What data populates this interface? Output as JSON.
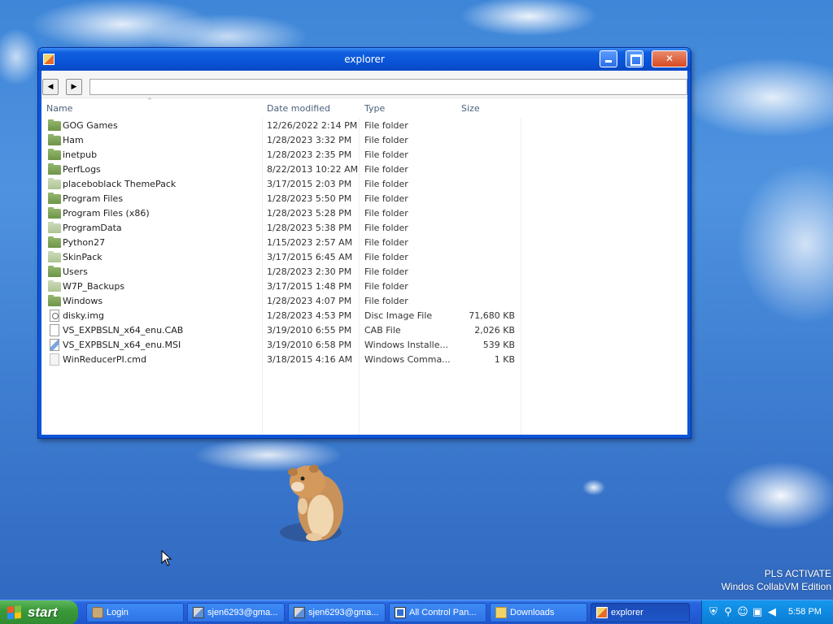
{
  "window": {
    "title": "explorer",
    "address_value": "",
    "nav_back_glyph": "◀",
    "nav_forward_glyph": "▶"
  },
  "list": {
    "columns": [
      "Name",
      "Date modified",
      "Type",
      "Size"
    ],
    "sort_indicator": "^",
    "rows": [
      {
        "name": "GOG Games",
        "date": "12/26/2022 2:14 PM",
        "type": "File folder",
        "size": "",
        "icon": "folder-icon"
      },
      {
        "name": "Ham",
        "date": "1/28/2023 3:32 PM",
        "type": "File folder",
        "size": "",
        "icon": "folder-icon"
      },
      {
        "name": "inetpub",
        "date": "1/28/2023 2:35 PM",
        "type": "File folder",
        "size": "",
        "icon": "folder-icon"
      },
      {
        "name": "PerfLogs",
        "date": "8/22/2013 10:22 AM",
        "type": "File folder",
        "size": "",
        "icon": "folder-icon"
      },
      {
        "name": "placeboblack ThemePack",
        "date": "3/17/2015 2:03 PM",
        "type": "File folder",
        "size": "",
        "icon": "folder-light-icon"
      },
      {
        "name": "Program Files",
        "date": "1/28/2023 5:50 PM",
        "type": "File folder",
        "size": "",
        "icon": "folder-icon"
      },
      {
        "name": "Program Files (x86)",
        "date": "1/28/2023 5:28 PM",
        "type": "File folder",
        "size": "",
        "icon": "folder-icon"
      },
      {
        "name": "ProgramData",
        "date": "1/28/2023 5:38 PM",
        "type": "File folder",
        "size": "",
        "icon": "folder-light-icon"
      },
      {
        "name": "Python27",
        "date": "1/15/2023 2:57 AM",
        "type": "File folder",
        "size": "",
        "icon": "folder-icon"
      },
      {
        "name": "SkinPack",
        "date": "3/17/2015 6:45 AM",
        "type": "File folder",
        "size": "",
        "icon": "folder-light-icon"
      },
      {
        "name": "Users",
        "date": "1/28/2023 2:30 PM",
        "type": "File folder",
        "size": "",
        "icon": "folder-icon"
      },
      {
        "name": "W7P_Backups",
        "date": "3/17/2015 1:48 PM",
        "type": "File folder",
        "size": "",
        "icon": "folder-light-icon"
      },
      {
        "name": "Windows",
        "date": "1/28/2023 4:07 PM",
        "type": "File folder",
        "size": "",
        "icon": "folder-icon"
      },
      {
        "name": "disky.img",
        "date": "1/28/2023 4:53 PM",
        "type": "Disc Image File",
        "size": "71,680 KB",
        "icon": "disk-image-icon"
      },
      {
        "name": "VS_EXPBSLN_x64_enu.CAB",
        "date": "3/19/2010 6:55 PM",
        "type": "CAB File",
        "size": "2,026 KB",
        "icon": "file-icon"
      },
      {
        "name": "VS_EXPBSLN_x64_enu.MSI",
        "date": "3/19/2010 6:58 PM",
        "type": "Windows Installe...",
        "size": "539 KB",
        "icon": "installer-icon"
      },
      {
        "name": "WinReducerPI.cmd",
        "date": "3/18/2015 4:16 AM",
        "type": "Windows Comma...",
        "size": "1 KB",
        "icon": "cmd-file-icon"
      }
    ]
  },
  "desktop": {
    "watermark_line1": "PLS ACTIVATE",
    "watermark_line2": "Windos CollabVM Edition"
  },
  "taskbar": {
    "start_label": "start",
    "tasks": [
      {
        "label": "Login",
        "icon": "login-icon",
        "active": false
      },
      {
        "label": "sjen6293@gma...",
        "icon": "remote-desktop-icon",
        "active": false
      },
      {
        "label": "sjen6293@gma...",
        "icon": "remote-desktop-icon",
        "active": false
      },
      {
        "label": "All Control Pan...",
        "icon": "control-panel-icon",
        "active": false
      },
      {
        "label": "Downloads",
        "icon": "folder-icon",
        "active": false
      },
      {
        "label": "explorer",
        "icon": "explorer-icon",
        "active": true
      }
    ],
    "clock": "5:58 PM"
  }
}
